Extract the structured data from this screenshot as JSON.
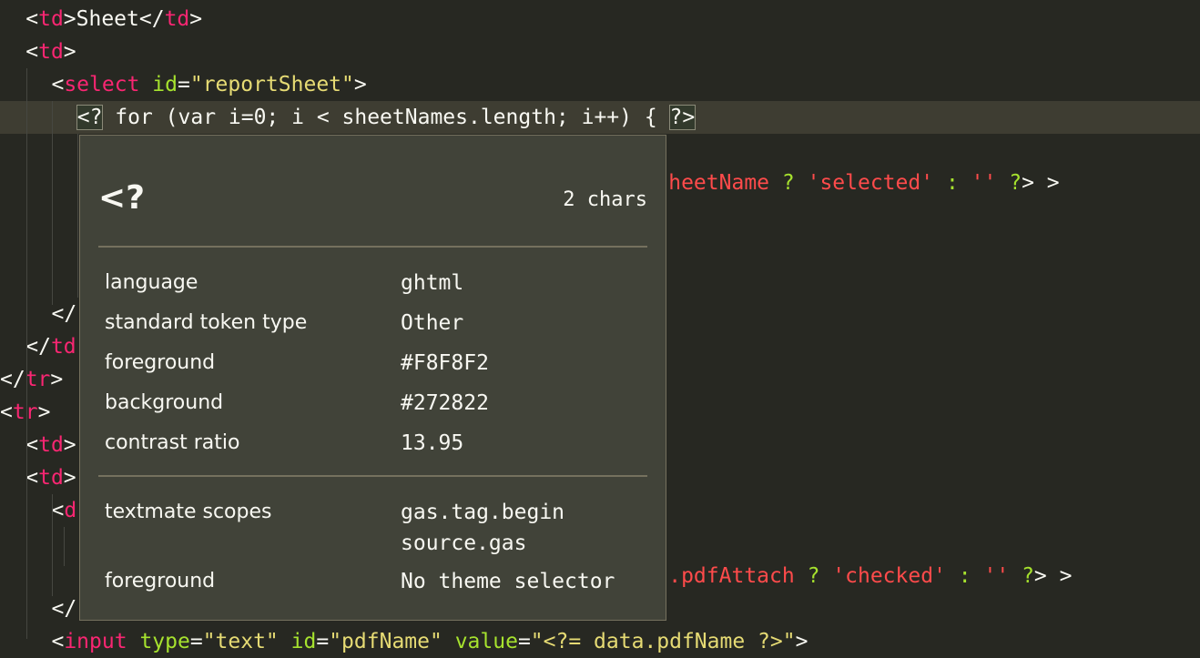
{
  "theme_colors": {
    "background": "#272822",
    "foreground": "#F8F8F2",
    "tag": "#f92672",
    "attribute": "#a6e22e",
    "string": "#e6db74"
  },
  "code_lines": [
    {
      "col": 2,
      "tokens": [
        [
          "txt",
          "<"
        ],
        [
          "tag",
          "td"
        ],
        [
          "txt",
          ">Sheet</"
        ],
        [
          "tag",
          "td"
        ],
        [
          "txt",
          ">"
        ]
      ]
    },
    {
      "col": 2,
      "tokens": [
        [
          "txt",
          "<"
        ],
        [
          "tag",
          "td"
        ],
        [
          "txt",
          ">"
        ]
      ]
    },
    {
      "col": 4,
      "tokens": [
        [
          "txt",
          "<"
        ],
        [
          "tag",
          "select"
        ],
        [
          "txt",
          " "
        ],
        [
          "attr",
          "id"
        ],
        [
          "txt",
          "="
        ],
        [
          "str",
          "\"reportSheet\""
        ],
        [
          "txt",
          ">"
        ]
      ]
    },
    {
      "col": 6,
      "current": true,
      "tokens": [
        [
          "bracket",
          "<?"
        ],
        [
          "txt",
          " for (var i=0; i < sheetNames.length; i++) { "
        ],
        [
          "bracket",
          "?>"
        ]
      ]
    },
    {
      "col": 0,
      "tokens": []
    },
    {
      "col": 52,
      "tokens": [
        [
          "var",
          "heetName"
        ],
        [
          "txt",
          " "
        ],
        [
          "op",
          "?"
        ],
        [
          "txt",
          " "
        ],
        [
          "var",
          "'selected'"
        ],
        [
          "txt",
          " "
        ],
        [
          "op",
          ":"
        ],
        [
          "txt",
          " "
        ],
        [
          "var",
          "''"
        ],
        [
          "txt",
          " "
        ],
        [
          "op",
          "?"
        ],
        [
          "txt",
          "> >"
        ]
      ]
    },
    {
      "col": 0,
      "tokens": []
    },
    {
      "col": 0,
      "tokens": []
    },
    {
      "col": 0,
      "tokens": []
    },
    {
      "col": 4,
      "tokens": [
        [
          "txt",
          "</"
        ]
      ]
    },
    {
      "col": 2,
      "tokens": [
        [
          "txt",
          "</"
        ],
        [
          "tag",
          "td"
        ]
      ]
    },
    {
      "col": 0,
      "tokens": [
        [
          "txt",
          "</"
        ],
        [
          "tag",
          "tr"
        ],
        [
          "txt",
          ">"
        ]
      ]
    },
    {
      "col": 0,
      "tokens": [
        [
          "txt",
          "<"
        ],
        [
          "tag",
          "tr"
        ],
        [
          "txt",
          ">"
        ]
      ]
    },
    {
      "col": 2,
      "tokens": [
        [
          "txt",
          "<"
        ],
        [
          "tag",
          "td"
        ],
        [
          "txt",
          ">"
        ]
      ]
    },
    {
      "col": 2,
      "tokens": [
        [
          "txt",
          "<"
        ],
        [
          "tag",
          "td"
        ],
        [
          "txt",
          ">"
        ]
      ]
    },
    {
      "col": 4,
      "tokens": [
        [
          "txt",
          "<"
        ],
        [
          "tag",
          "d"
        ]
      ]
    },
    {
      "col": 0,
      "tokens": []
    },
    {
      "col": 52,
      "tokens": [
        [
          "var",
          ".pdfAttach"
        ],
        [
          "txt",
          " "
        ],
        [
          "op",
          "?"
        ],
        [
          "txt",
          " "
        ],
        [
          "var",
          "'checked'"
        ],
        [
          "txt",
          " "
        ],
        [
          "op",
          ":"
        ],
        [
          "txt",
          " "
        ],
        [
          "var",
          "''"
        ],
        [
          "txt",
          " "
        ],
        [
          "op",
          "?"
        ],
        [
          "txt",
          "> >"
        ]
      ]
    },
    {
      "col": 4,
      "tokens": [
        [
          "txt",
          "</"
        ]
      ]
    },
    {
      "col": 4,
      "tokens": [
        [
          "txt",
          "<"
        ],
        [
          "tag",
          "input"
        ],
        [
          "txt",
          " "
        ],
        [
          "attr",
          "type"
        ],
        [
          "txt",
          "="
        ],
        [
          "str",
          "\"text\""
        ],
        [
          "txt",
          " "
        ],
        [
          "attr",
          "id"
        ],
        [
          "txt",
          "="
        ],
        [
          "str",
          "\"pdfName\""
        ],
        [
          "txt",
          " "
        ],
        [
          "attr",
          "value"
        ],
        [
          "txt",
          "="
        ],
        [
          "str",
          "\"<?= data.pdfName ?>\""
        ],
        [
          "txt",
          ">"
        ]
      ]
    }
  ],
  "inspector": {
    "token": "<?",
    "length": "2 chars",
    "rows": [
      {
        "label": "language",
        "value": "ghtml"
      },
      {
        "label": "standard token type",
        "value": "Other"
      },
      {
        "label": "foreground",
        "value": "#F8F8F2"
      },
      {
        "label": "background",
        "value": "#272822"
      },
      {
        "label": "contrast ratio",
        "value": "13.95"
      }
    ],
    "scopes_label": "textmate scopes",
    "scopes": [
      "gas.tag.begin",
      "source.gas"
    ],
    "fg_label": "foreground",
    "fg_value": "No theme selector"
  }
}
